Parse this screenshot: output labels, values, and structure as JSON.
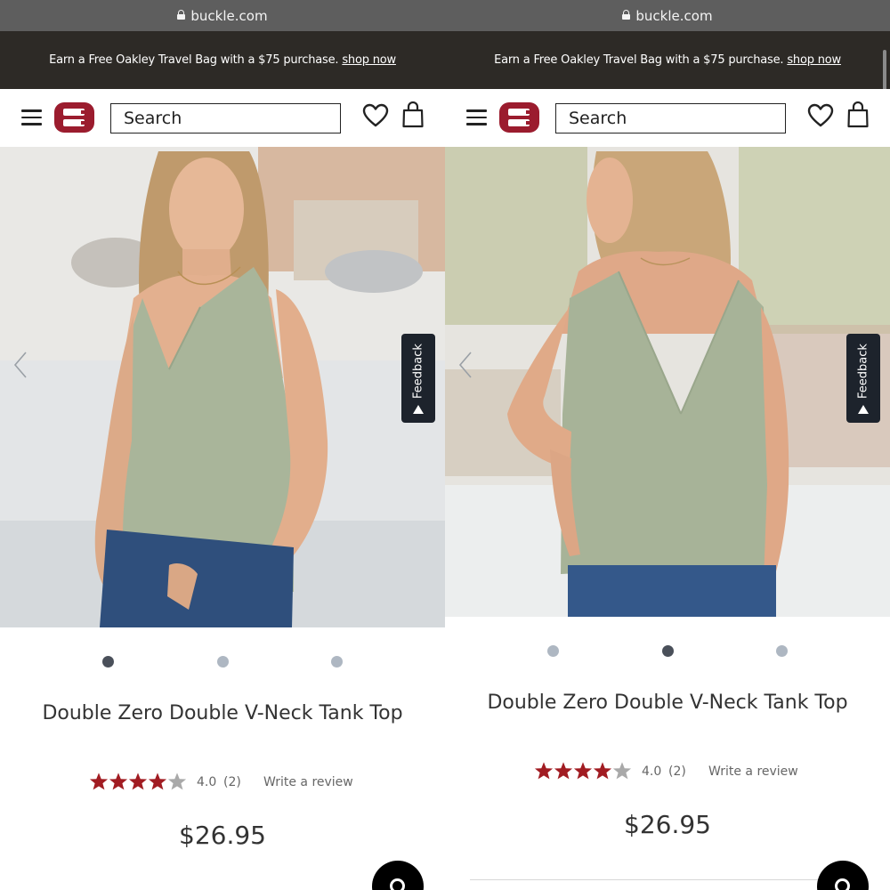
{
  "browser": {
    "url": "buckle.com"
  },
  "promo": {
    "text": "Earn a Free Oakley Travel Bag with a $75 purchase.",
    "link": "shop now"
  },
  "header": {
    "search_placeholder": "Search",
    "logo_letter": "B",
    "brand_color": "#9b1c2e"
  },
  "feedback": {
    "label": "Feedback"
  },
  "product": {
    "name": "Double Zero Double V-Neck Tank Top",
    "rating": "4.0",
    "rating_value": 4.0,
    "review_count": "(2)",
    "write_review": "Write a review",
    "price": "$26.95",
    "star_color": "#a11c22"
  },
  "panes": [
    {
      "image_view": "front",
      "active_slide": 1,
      "slide_count": 3
    },
    {
      "image_view": "back",
      "active_slide": 2,
      "slide_count": 3
    }
  ],
  "icons": [
    "lock-icon",
    "menu-icon",
    "buckle-logo",
    "heart-icon",
    "shopping-bag-icon",
    "chevron-left-icon",
    "feedback-arrow-icon",
    "star-icon",
    "search-chat-icon"
  ]
}
